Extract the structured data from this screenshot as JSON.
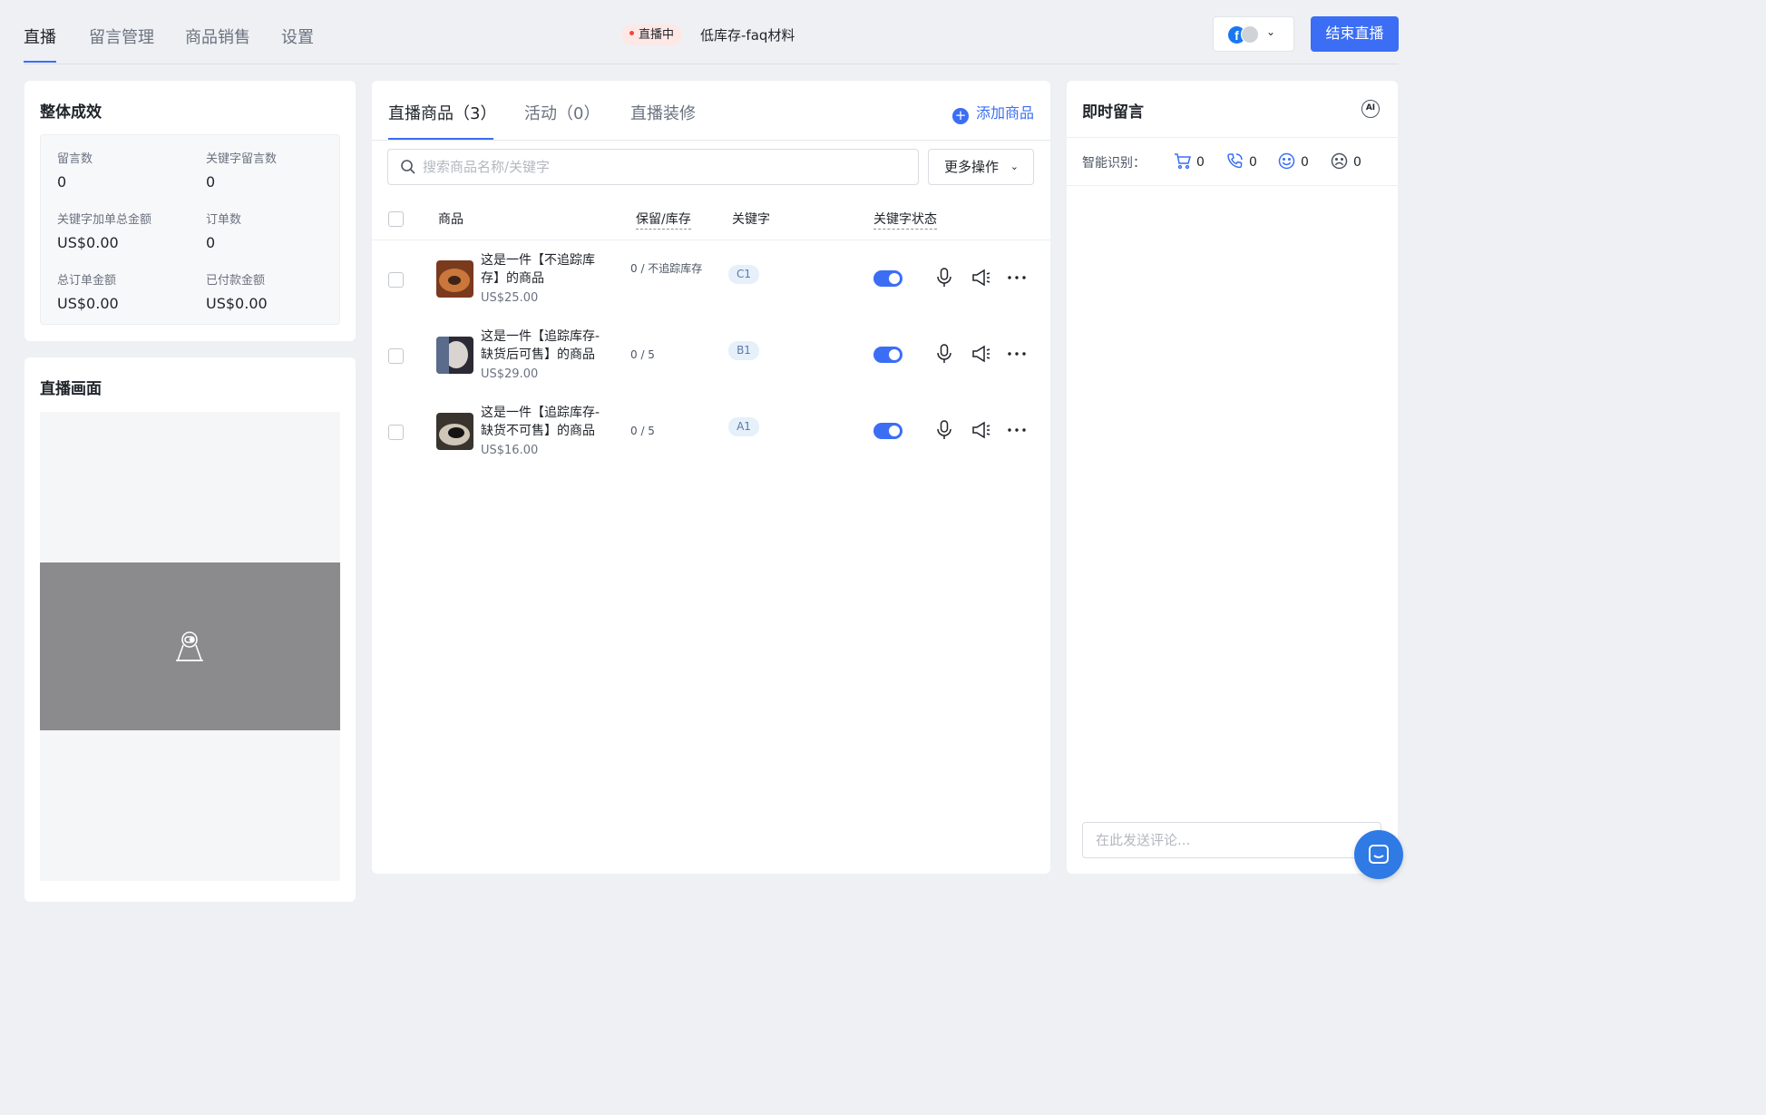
{
  "nav": {
    "tabs": [
      {
        "label": "直播",
        "active": true
      },
      {
        "label": "留言管理",
        "active": false
      },
      {
        "label": "商品销售",
        "active": false
      },
      {
        "label": "设置",
        "active": false
      }
    ]
  },
  "header": {
    "live_badge": "直播中",
    "live_title": "低库存-faq材料",
    "account_icon": "facebook-icon",
    "account_glyph": "f",
    "end_button": "结束直播"
  },
  "performance": {
    "title": "整体成效",
    "metrics": [
      {
        "label": "留言数",
        "value": "0"
      },
      {
        "label": "关键字留言数",
        "value": "0"
      },
      {
        "label": "关键字加单总金额",
        "value": "US$0.00"
      },
      {
        "label": "订单数",
        "value": "0"
      },
      {
        "label": "总订单金额",
        "value": "US$0.00"
      },
      {
        "label": "已付款金额",
        "value": "US$0.00"
      }
    ]
  },
  "live_view": {
    "title": "直播画面",
    "placeholder_icon": "webcam-icon"
  },
  "products": {
    "tabs": [
      {
        "label": "直播商品（3）",
        "active": true
      },
      {
        "label": "活动（0）",
        "active": false
      },
      {
        "label": "直播装修",
        "active": false
      }
    ],
    "add_label": "添加商品",
    "search_placeholder": "搜索商品名称/关键字",
    "more_ops": "更多操作",
    "columns": {
      "product": "商品",
      "stock": "保留/库存",
      "keyword": "关键字",
      "keyword_status": "关键字状态"
    },
    "rows": [
      {
        "name": "这是一件【不追踪库存】的商品",
        "price": "US$25.00",
        "stock": "0 / 不追踪库存",
        "keyword": "C1",
        "keyword_enabled": true,
        "thumb_colors": [
          "#7a3a1e",
          "#c9773a",
          "#3d2416"
        ]
      },
      {
        "name": "这是一件【追踪库存-缺货后可售】的商品",
        "price": "US$29.00",
        "stock": "0 / 5",
        "keyword": "B1",
        "keyword_enabled": true,
        "thumb_colors": [
          "#2c2b35",
          "#d9d4cf",
          "#5a6b8c"
        ]
      },
      {
        "name": "这是一件【追踪库存-缺货不可售】的商品",
        "price": "US$16.00",
        "stock": "0 / 5",
        "keyword": "A1",
        "keyword_enabled": true,
        "thumb_colors": [
          "#3a342e",
          "#cfc6b8",
          "#161412"
        ]
      }
    ]
  },
  "comments": {
    "title": "即时留言",
    "ai_label": "AI",
    "smart_label": "智能识别：",
    "stats": [
      {
        "icon": "cart-icon",
        "value": "0"
      },
      {
        "icon": "phone-icon",
        "value": "0"
      },
      {
        "icon": "smile-icon",
        "value": "0"
      },
      {
        "icon": "frown-icon",
        "value": "0"
      }
    ],
    "input_placeholder": "在此发送评论..."
  },
  "colors": {
    "accent": "#3b6ef5",
    "live_dot": "#f04a3a",
    "background": "#eef0f3"
  }
}
